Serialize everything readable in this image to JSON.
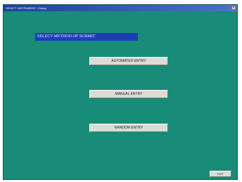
{
  "window": {
    "title": "SELECT INSTRUMENT - Dialog",
    "close_glyph": "×"
  },
  "heading": {
    "text": "SELECT METHOD OF SUBMIT"
  },
  "menu": {
    "buttons": [
      {
        "label": "AUTOMATED ENTRY"
      },
      {
        "label": "MANUAL ENTRY"
      },
      {
        "label": "RANDOM ENTRY"
      }
    ],
    "exit_label": "EXIT"
  },
  "colors": {
    "background": "#188c78",
    "heading_bg": "#1d3fb0",
    "button_bg": "#d9ddd6",
    "titlebar": "#1f3f9e"
  }
}
